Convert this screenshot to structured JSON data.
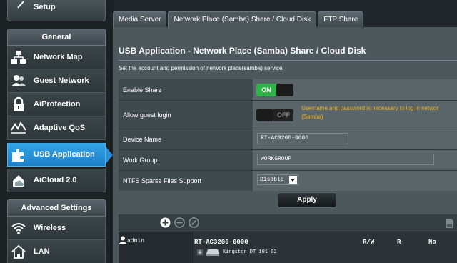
{
  "sidebar": {
    "setup_label": "Setup",
    "general_heading": "General",
    "items": [
      {
        "label": "Network Map"
      },
      {
        "label": "Guest Network"
      },
      {
        "label": "AiProtection"
      },
      {
        "label": "Adaptive QoS"
      },
      {
        "label": "USB Application"
      },
      {
        "label": "AiCloud 2.0"
      }
    ],
    "advanced_heading": "Advanced Settings",
    "advanced_items": [
      {
        "label": "Wireless"
      },
      {
        "label": "LAN"
      }
    ]
  },
  "tabs": [
    {
      "label": "Media Server"
    },
    {
      "label": "Network Place (Samba) Share / Cloud Disk"
    },
    {
      "label": "FTP Share"
    }
  ],
  "main": {
    "title": "USB Application - Network Place (Samba) Share / Cloud Disk",
    "description": "Set the account and permission of network place(samba) service.",
    "form": {
      "enable_share_label": "Enable Share",
      "enable_share_state": "ON",
      "guest_login_label": "Allow guest login",
      "guest_login_state": "OFF",
      "guest_note_line1": "Username and password is necessary to log in networ",
      "guest_note_line2": "(Samba)",
      "device_name_label": "Device Name",
      "device_name_value": "RT-AC3200-0000",
      "work_group_label": "Work Group",
      "work_group_value": "WORKGROUP",
      "ntfs_label": "NTFS Sparse Files Support",
      "ntfs_value": "Disable"
    },
    "apply_label": "Apply",
    "accounts": {
      "user": "admin",
      "device": "RT-AC3200-0000",
      "col_rw": "R/W",
      "col_r": "R",
      "col_no": "No",
      "disk": "Kingston DT 101 G2"
    }
  },
  "colors": {
    "accent": "#2a90d6",
    "on_green": "#2fb34a",
    "warning": "#f3b21c"
  }
}
